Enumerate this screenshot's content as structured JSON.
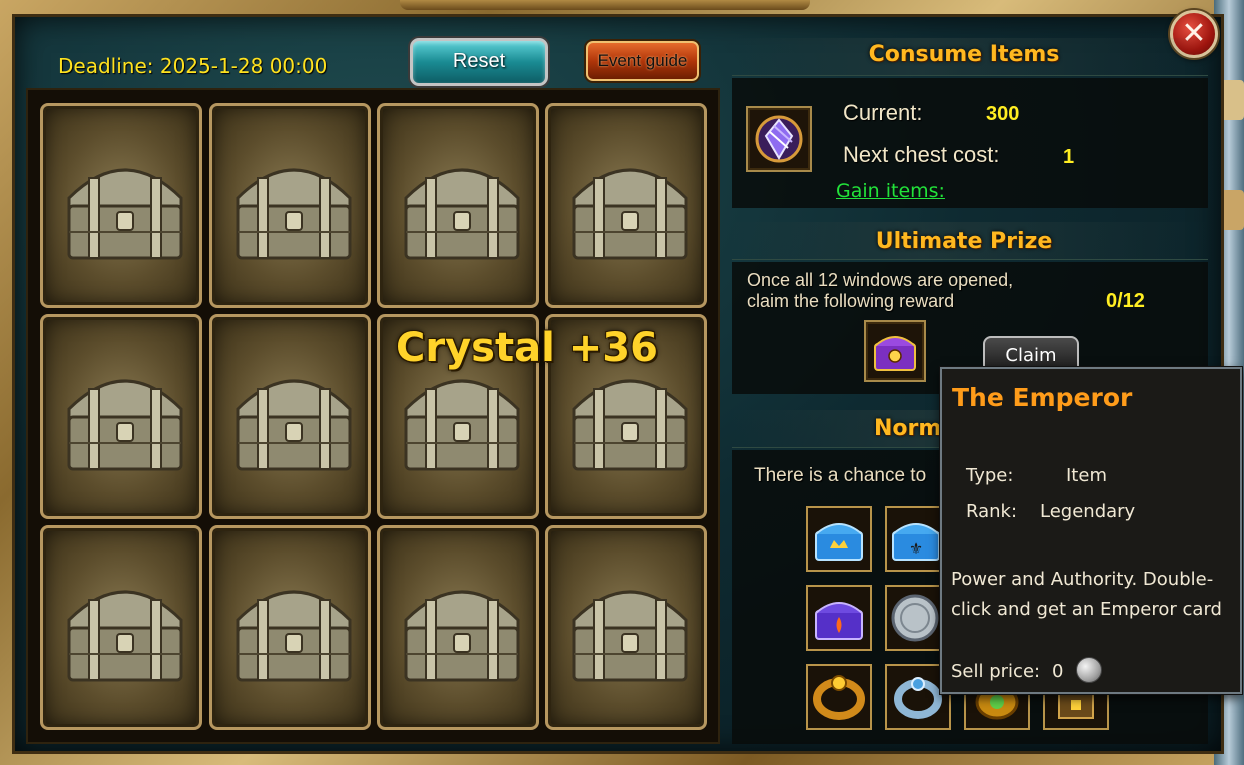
{
  "header": {
    "deadline": "Deadline: 2025-1-28 00:00",
    "reset_label": "Reset",
    "guide_label": "Event guide",
    "close_icon": "close-icon"
  },
  "grid": {
    "chest_count": 12,
    "popup_text": "Crystal +36"
  },
  "consume": {
    "title": "Consume Items",
    "current_label": "Current:",
    "current_value": "300",
    "next_cost_label": "Next chest cost:",
    "next_cost_value": "1",
    "gain_link": "Gain items:",
    "item_icon": "crystal-item-icon"
  },
  "ultimate": {
    "title": "Ultimate Prize",
    "desc_line1": "Once all 12 windows are opened,",
    "desc_line2": "claim the following reward",
    "progress": "0/12",
    "claim_label": "Claim",
    "reward_icon": "emperor-chest-icon"
  },
  "normal": {
    "title_visible": "Norm",
    "desc_visible": "There is a chance to",
    "reward_icons": [
      "blue-crown-chest-icon",
      "blue-fleur-chest-icon",
      "purple-flame-chest-icon",
      "silver-coin-icon",
      "gold-ring-icon",
      "silver-ring-icon",
      "gold-amulet-icon",
      "treasure-box-icon"
    ]
  },
  "tooltip": {
    "title": "The Emperor",
    "type_label": "Type:",
    "type_value": "Item",
    "rank_label": "Rank:",
    "rank_value": "Legendary",
    "description": "Power and Authority. Double-click and get an Emperor card",
    "sell_label": "Sell price:",
    "sell_value": "0",
    "coin_icon": "silver-coin-icon"
  },
  "colors": {
    "deadline": "#ffe21f",
    "title_gold": "#ffb820",
    "value_yellow": "#ffee22",
    "link_green": "#22e23a",
    "tooltip_title": "#ff9c1a"
  }
}
